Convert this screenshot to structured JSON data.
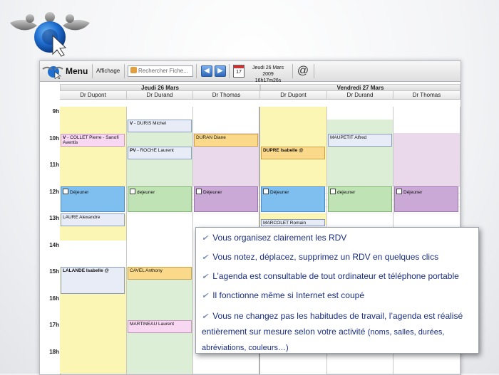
{
  "toolbar": {
    "menu": "Menu",
    "affichage": "Affichage",
    "search_placeholder": "Rechercher Fiche...",
    "calendar_day": "17",
    "date_line1": "Jeudi 26 Mars 2009",
    "date_line2": "16h17m26s",
    "at_symbol": "@"
  },
  "days": [
    "Jeudi 26 Mars",
    "Vendredi 27 Mars"
  ],
  "doctors": [
    "Dr Dupont",
    "Dr Durand",
    "Dr Thomas",
    "Dr Dupont",
    "Dr Durand",
    "Dr Thomas"
  ],
  "hours": [
    "9h",
    "10h",
    "11h",
    "12h",
    "13h",
    "14h",
    "15h",
    "16h",
    "17h",
    "18h"
  ],
  "lunch": {
    "col1": "Déjeuner",
    "col2": "dejeuner",
    "col3": "Déjeuner",
    "col4": "Déjeuner",
    "col5": "dejeuner",
    "col6": "Déjeuner"
  },
  "appointments": {
    "duris_prefix": "V",
    "duris": "- DURIS Michel",
    "collet_prefix": "V",
    "collet": "- COLLET Pierre - Sanofi Aventis",
    "duran": "DURAN Diane",
    "maupetit": "MAUPETIT Alfred",
    "roche_prefix": "PV",
    "roche": "- ROCHE Laurent",
    "dupre": "DUPRE Isabelle @",
    "laure": "LAURE Alexandre",
    "marcolet": "MARCOLET Romain",
    "lalande": "LALANDE Isabelle @",
    "cavel": "CAVEL Anthony",
    "martineau": "MARTINEAU Laurent"
  },
  "features": [
    "Vous organisez clairement les RDV",
    "Vous notez, déplacez, supprimez un RDV en quelques clics",
    "L’agenda est consultable de tout ordinateur et téléphone portable",
    "Il fonctionne même si Internet est coupé",
    "Vous ne changez pas les habitudes de travail, l’agenda est réalisé entièrement sur mesure selon votre activité"
  ],
  "features_note": "(noms, salles, durées, abréviations, couleurs…)",
  "check_symbol": "✔",
  "colors": {
    "yellow": "#fbf6b4",
    "green": "#dcefd6",
    "purple": "#ead9ea",
    "lunch_blue": "#7ebff0",
    "lunch_green": "#bfe3b4",
    "lunch_purple": "#caa9d6",
    "text_blue": "#1a2e82"
  }
}
